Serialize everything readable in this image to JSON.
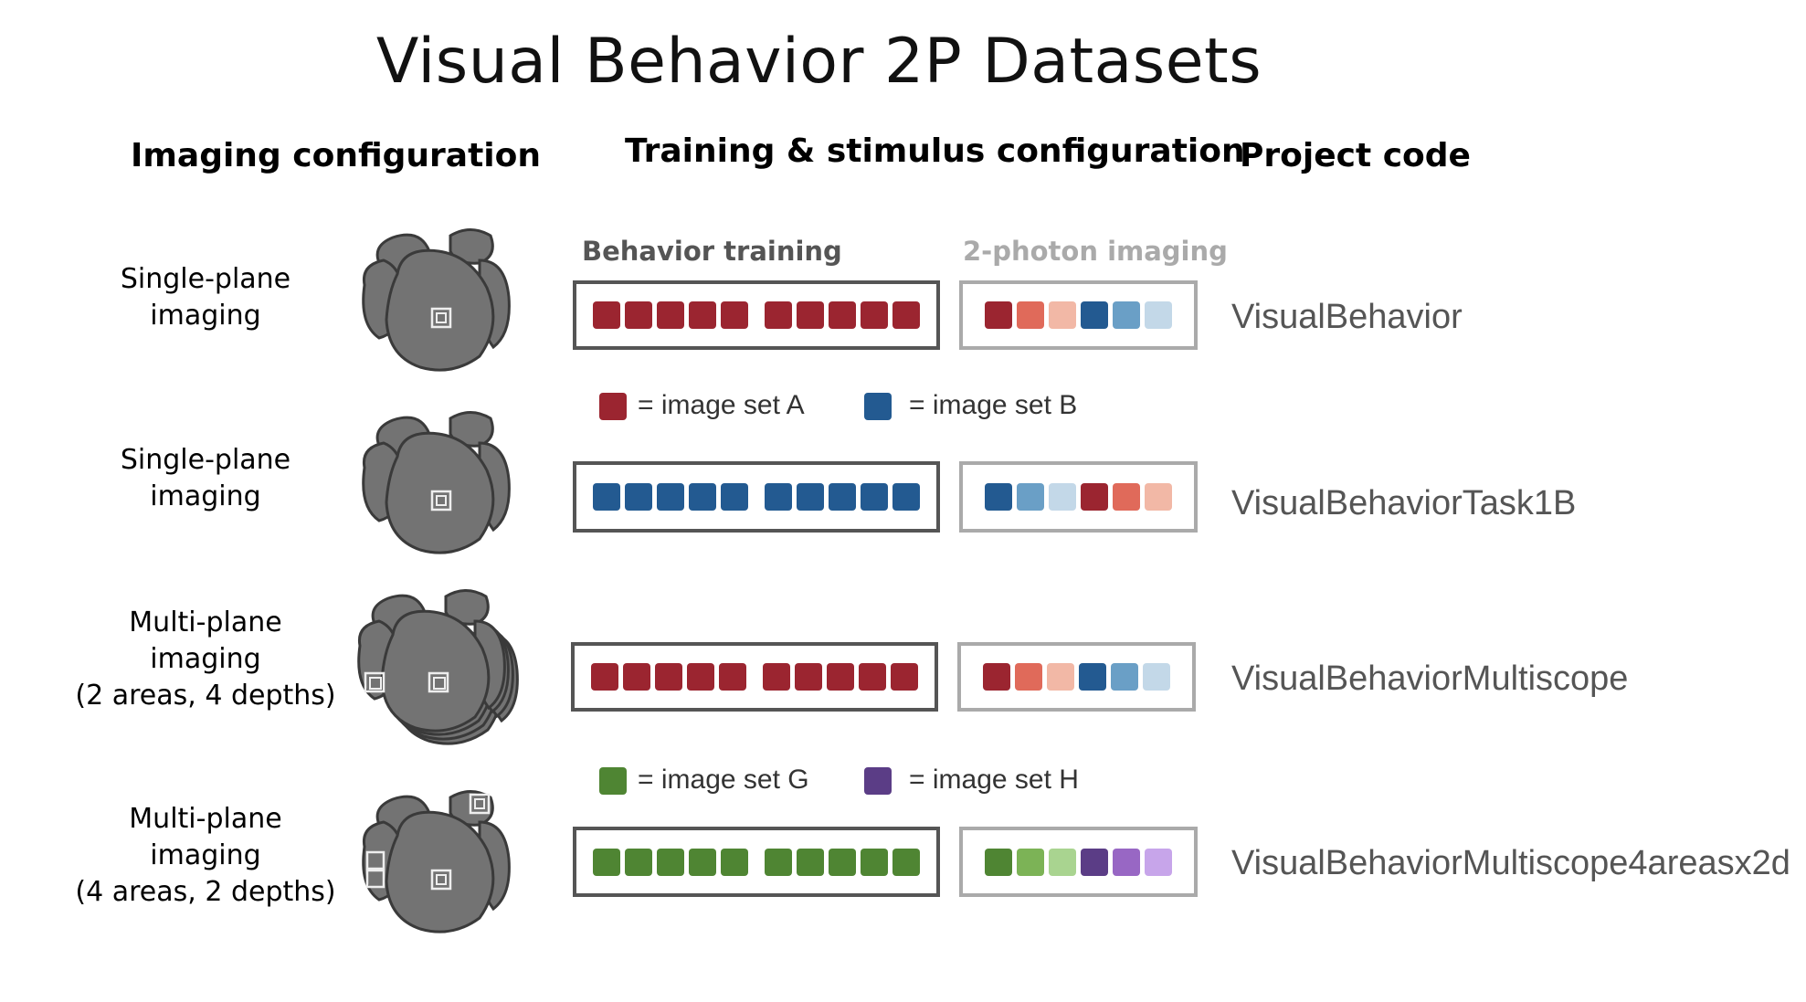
{
  "title": "Visual Behavior 2P Datasets",
  "headers": {
    "imaging": "Imaging configuration",
    "training": "Training & stimulus configuration",
    "project": "Project code"
  },
  "subheaders": {
    "behavior_training": "Behavior training",
    "two_photon": "2-photon imaging"
  },
  "colors": {
    "set_a": [
      "#9b2530",
      "#e06a5a",
      "#f2b8a6"
    ],
    "set_b": [
      "#235a91",
      "#6a9fc6",
      "#c3d8e8"
    ],
    "set_g": [
      "#4f8533",
      "#7cb356",
      "#a9d490"
    ],
    "set_h": [
      "#5b3d86",
      "#9867c4",
      "#c7a5ea"
    ],
    "brain_fill": "#737373",
    "brain_outline": "#3a3a3a"
  },
  "legends": {
    "top": [
      {
        "label": "= image set A",
        "color": "#9b2530"
      },
      {
        "label": "= image set B",
        "color": "#235a91"
      }
    ],
    "bottom": [
      {
        "label": "= image set G",
        "color": "#4f8533"
      },
      {
        "label": "= image set H",
        "color": "#5b3d86"
      }
    ]
  },
  "rows": [
    {
      "label": "Single-plane\nimaging",
      "brain_icon": "single-plane-brain-icon",
      "training_colors": [
        "#9b2530",
        "#9b2530",
        "#9b2530",
        "#9b2530",
        "#9b2530",
        "#9b2530",
        "#9b2530",
        "#9b2530",
        "#9b2530",
        "#9b2530"
      ],
      "imaging_colors": [
        "#9b2530",
        "#e06a5a",
        "#f2b8a6",
        "#235a91",
        "#6a9fc6",
        "#c3d8e8"
      ],
      "project_code": "VisualBehavior"
    },
    {
      "label": "Single-plane\nimaging",
      "brain_icon": "single-plane-brain-icon",
      "training_colors": [
        "#235a91",
        "#235a91",
        "#235a91",
        "#235a91",
        "#235a91",
        "#235a91",
        "#235a91",
        "#235a91",
        "#235a91",
        "#235a91"
      ],
      "imaging_colors": [
        "#235a91",
        "#6a9fc6",
        "#c3d8e8",
        "#9b2530",
        "#e06a5a",
        "#f2b8a6"
      ],
      "project_code": "VisualBehaviorTask1B"
    },
    {
      "label": "Multi-plane\nimaging\n(2 areas, 4 depths)",
      "brain_icon": "multi-plane-brain-icon",
      "training_colors": [
        "#9b2530",
        "#9b2530",
        "#9b2530",
        "#9b2530",
        "#9b2530",
        "#9b2530",
        "#9b2530",
        "#9b2530",
        "#9b2530",
        "#9b2530"
      ],
      "imaging_colors": [
        "#9b2530",
        "#e06a5a",
        "#f2b8a6",
        "#235a91",
        "#6a9fc6",
        "#c3d8e8"
      ],
      "project_code": "VisualBehaviorMultiscope"
    },
    {
      "label": "Multi-plane\nimaging\n(4 areas, 2 depths)",
      "brain_icon": "multi-plane-brain-icon",
      "training_colors": [
        "#4f8533",
        "#4f8533",
        "#4f8533",
        "#4f8533",
        "#4f8533",
        "#4f8533",
        "#4f8533",
        "#4f8533",
        "#4f8533",
        "#4f8533"
      ],
      "imaging_colors": [
        "#4f8533",
        "#7cb356",
        "#a9d490",
        "#5b3d86",
        "#9867c4",
        "#c7a5ea"
      ],
      "project_code": "VisualBehaviorMultiscope4areasx2d"
    }
  ]
}
